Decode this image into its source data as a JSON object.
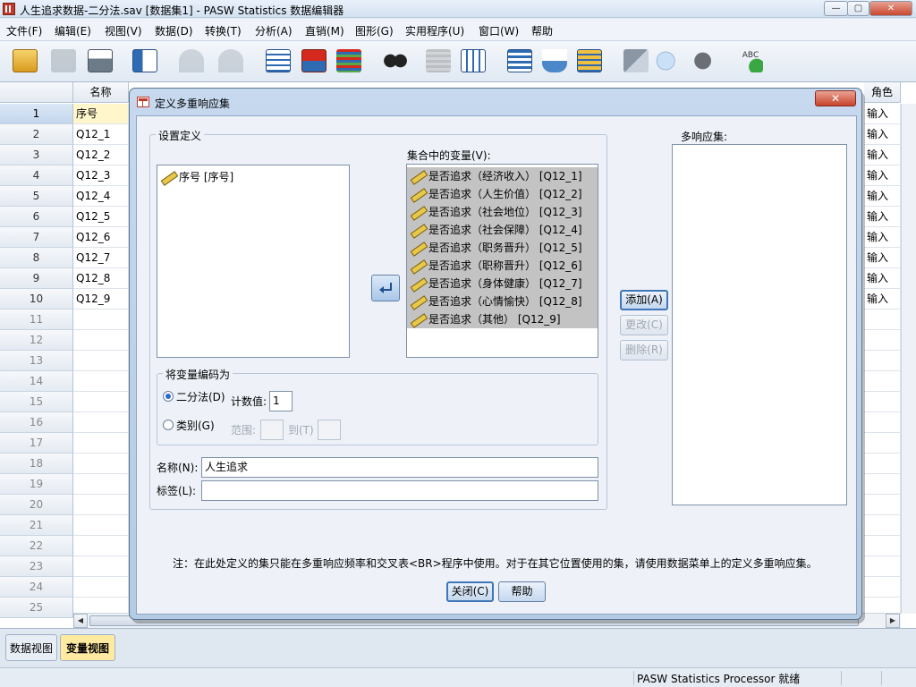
{
  "window": {
    "title": "人生追求数据-二分法.sav [数据集1] - PASW Statistics 数据编辑器",
    "minimize": "—",
    "maximize": "▢",
    "close": "✕"
  },
  "menu": [
    "文件(F)",
    "编辑(E)",
    "视图(V)",
    "数据(D)",
    "转换(T)",
    "分析(A)",
    "直销(M)",
    "图形(G)",
    "实用程序(U)",
    "窗口(W)",
    "帮助"
  ],
  "toolbar": {
    "icons": [
      "open-icon",
      "save-icon",
      "print-icon",
      "dialog-recall-icon",
      "undo-icon",
      "redo-icon",
      "goto-case-icon",
      "goto-variable-icon",
      "variables-icon",
      "find-icon",
      "insert-cases-icon",
      "insert-variable-icon",
      "split-file-icon",
      "weight-cases-icon",
      "select-cases-icon",
      "value-labels-icon",
      "use-sets-icon",
      "show-all-variables-icon",
      "spell-check-icon"
    ]
  },
  "grid": {
    "column_headers": [
      "名称",
      "",
      "",
      "",
      "",
      "",
      "",
      "",
      "",
      "",
      "角色"
    ],
    "rows": [
      {
        "num": "1",
        "name": "序号",
        "role": "输入"
      },
      {
        "num": "2",
        "name": "Q12_1",
        "role": "输入"
      },
      {
        "num": "3",
        "name": "Q12_2",
        "role": "输入"
      },
      {
        "num": "4",
        "name": "Q12_3",
        "role": "输入"
      },
      {
        "num": "5",
        "name": "Q12_4",
        "role": "输入"
      },
      {
        "num": "6",
        "name": "Q12_5",
        "role": "输入"
      },
      {
        "num": "7",
        "name": "Q12_6",
        "role": "输入"
      },
      {
        "num": "8",
        "name": "Q12_7",
        "role": "输入"
      },
      {
        "num": "9",
        "name": "Q12_8",
        "role": "输入"
      },
      {
        "num": "10",
        "name": "Q12_9",
        "role": "输入"
      }
    ],
    "empty_rows": [
      "11",
      "12",
      "13",
      "14",
      "15",
      "16",
      "17",
      "18",
      "19",
      "20",
      "21",
      "22",
      "23",
      "24",
      "25"
    ]
  },
  "tabs": {
    "data_view": "数据视图",
    "variable_view": "变量视图"
  },
  "status": {
    "text": "PASW Statistics Processor 就绪"
  },
  "dialog": {
    "title": "定义多重响应集",
    "close": "✕",
    "set_definition_legend": "设置定义",
    "source_list": [
      "序号 [序号]"
    ],
    "variables_in_set_label": "集合中的变量(V):",
    "variables_in_set": [
      "是否追求（经济收入） [Q12_1]",
      "是否追求（人生价值） [Q12_2]",
      "是否追求（社会地位） [Q12_3]",
      "是否追求（社会保障） [Q12_4]",
      "是否追求（职务晋升） [Q12_5]",
      "是否追求（职称晋升） [Q12_6]",
      "是否追求（身体健康） [Q12_7]",
      "是否追求（心情愉快） [Q12_8]",
      "是否追求（其他） [Q12_9]"
    ],
    "encode_legend": "将变量编码为",
    "dichotomy_label": "二分法(D)",
    "counted_value_label": "计数值:",
    "counted_value": "1",
    "categories_label": "类别(G)",
    "range_label": "范围:",
    "through_label": "到(T)",
    "range_from": "",
    "range_to": "",
    "name_label": "名称(N):",
    "name_value": "人生追求",
    "label_label": "标签(L):",
    "label_value": "",
    "mr_sets_label": "多响应集:",
    "mr_sets": [],
    "add_button": "添加(A)",
    "change_button": "更改(C)",
    "remove_button": "删除(R)",
    "note": "注：在此处定义的集只能在多重响应频率和交叉表<BR>程序中使用。对于在其它位置使用的集，请使用数据菜单上的定义多重响应集。",
    "close_button": "关闭(C)",
    "help_button": "帮助",
    "dichotomy_selected": true
  }
}
